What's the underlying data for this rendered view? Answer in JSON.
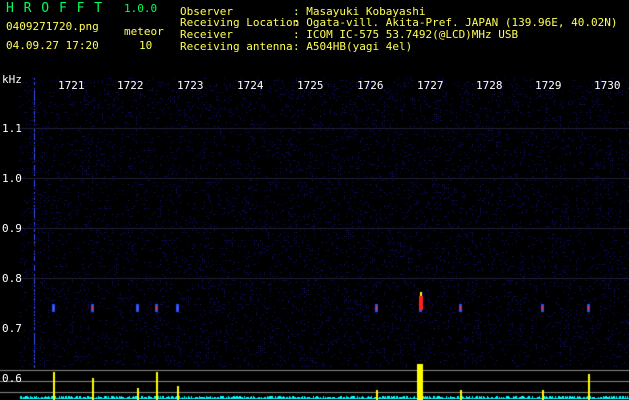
{
  "header": {
    "app_name": "H R O F F T",
    "version": "1.0.0",
    "file_name": "0409271720.png",
    "meteor_label": "meteor",
    "meteor_count": "10",
    "timestamp": "04.09.27 17:20"
  },
  "info": {
    "observer_label": "Observer",
    "observer_value": ": Masayuki Kobayashi",
    "location_label": "Receiving Location",
    "location_value": ": Ogata-vill. Akita-Pref. JAPAN (139.96E, 40.02N)",
    "receiver_label": "Receiver",
    "receiver_value": ": ICOM IC-575 53.7492(@LCD)MHz USB",
    "antenna_label": "Receiving antenna",
    "antenna_value": ": A504HB(yagi 4el)"
  },
  "axes": {
    "y_unit": "kHz",
    "time_ticks": [
      "1721",
      "1722",
      "1723",
      "1724",
      "1725",
      "1726",
      "1727",
      "1728",
      "1729",
      "1730"
    ],
    "freq_ticks": [
      "1.1",
      "1.0",
      "0.9",
      "0.8",
      "0.7",
      "0.6"
    ]
  },
  "colors": {
    "header_text": "#ffff55",
    "info_text": "#ffffff",
    "axis_text": "#ffffff",
    "grid_line": "#333344",
    "meteor_echo": "#ff3030",
    "signal_bar": "#ffff00",
    "noise_level": "#00ffff"
  }
}
